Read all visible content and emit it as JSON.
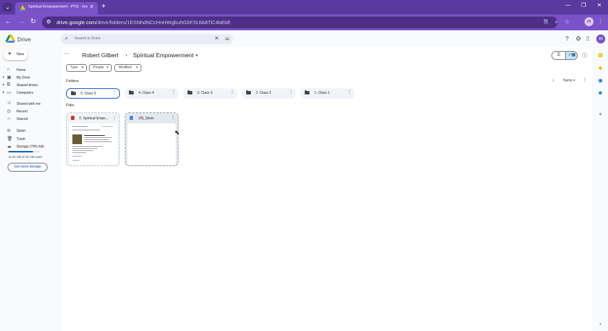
{
  "browser": {
    "tab_title": "Spiritual Empowerment - PTG - Googl",
    "url_domain": "drive.google.com",
    "url_path": "/drive/folders/1ESNhdNCcHnHWgbuhG6FSUlA8TiC4bEkE",
    "profile_initial": "m"
  },
  "drive": {
    "app_name": "Drive",
    "search_placeholder": "Search in Drive",
    "avatar_initial": "m",
    "new_label": "New",
    "sidebar": [
      {
        "label": "Home",
        "icon": "home-icon"
      },
      {
        "label": "My Drive",
        "icon": "my-drive-icon"
      },
      {
        "label": "Shared drives",
        "icon": "shared-drives-icon"
      },
      {
        "label": "Computers",
        "icon": "computers-icon"
      },
      {
        "label": "Shared with me",
        "icon": "shared-with-me-icon"
      },
      {
        "label": "Recent",
        "icon": "recent-icon"
      },
      {
        "label": "Starred",
        "icon": "starred-icon"
      },
      {
        "label": "Spam",
        "icon": "spam-icon"
      },
      {
        "label": "Trash",
        "icon": "trash-icon"
      },
      {
        "label": "Storage (79% full)",
        "icon": "storage-icon"
      }
    ],
    "storage_used_fraction": 0.79,
    "storage_text": "11.52 GB of 15 GB used",
    "get_storage": "Get more storage",
    "breadcrumb": [
      "Robert Gilbert",
      "Spiritual Empowerment"
    ],
    "filters": [
      "Type",
      "People",
      "Modified"
    ],
    "folders_title": "Folders",
    "files_title": "Files",
    "sort_label": "Name",
    "folders": [
      "5. Class 5",
      "4. Class 4",
      "3. Class 3",
      "2. Class 2",
      "1. Class 1"
    ],
    "files": [
      {
        "name": "0. Spiritual Empo...",
        "type": "pdf",
        "color": "#d93025"
      },
      {
        "name": ".DS_Store",
        "type": "doc",
        "color": "#4285f4"
      }
    ]
  },
  "colors": {
    "accent": "#7b52c7",
    "selected_border": "#0b57d0"
  }
}
